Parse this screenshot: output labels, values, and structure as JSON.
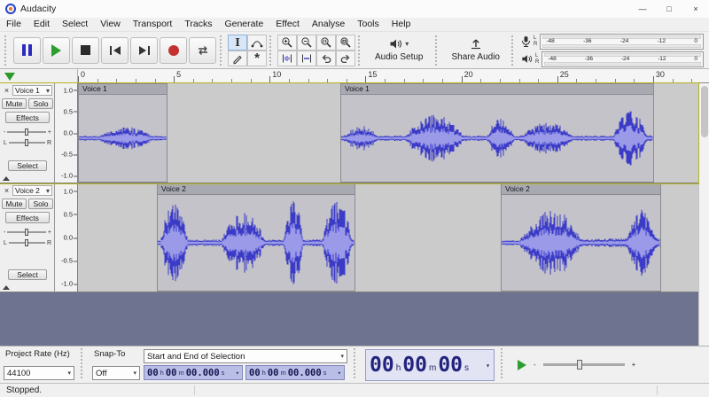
{
  "window": {
    "title": "Audacity"
  },
  "icons": {
    "minimize": "—",
    "maximize": "□",
    "close": "×",
    "dropdown": "▾",
    "multi_tool": "*",
    "selection_tool": "I"
  },
  "menu": {
    "items": [
      "File",
      "Edit",
      "Select",
      "View",
      "Transport",
      "Tracks",
      "Generate",
      "Effect",
      "Analyse",
      "Tools",
      "Help"
    ]
  },
  "toolbar": {
    "audio_setup_label": "Audio Setup",
    "share_audio_label": "Share Audio"
  },
  "meters": {
    "channels": [
      "L",
      "R"
    ],
    "scale": [
      "-48",
      "-36",
      "-24",
      "-12",
      "0"
    ]
  },
  "timeline": {
    "ticks": [
      "0",
      "5",
      "10",
      "15",
      "20",
      "25",
      "30"
    ]
  },
  "scale": [
    "1.0",
    "0.5",
    "0.0",
    "-0.5",
    "-1.0"
  ],
  "panel": {
    "mute": "Mute",
    "solo": "Solo",
    "effects": "Effects",
    "select": "Select",
    "gain_minus": "-",
    "gain_plus": "+",
    "pan_left": "L",
    "pan_right": "R"
  },
  "tracks": [
    {
      "name": "Voice 1",
      "clips": [
        {
          "label": "Voice 1",
          "start": 0,
          "end": 4.65,
          "seed": 3,
          "intensity": 0.75
        },
        {
          "label": "Voice 1",
          "start": 13.7,
          "end": 30.05,
          "seed": 11,
          "intensity": 0.85
        }
      ]
    },
    {
      "name": "Voice 2",
      "clips": [
        {
          "label": "Voice 2",
          "start": 4.1,
          "end": 14.45,
          "seed": 5,
          "intensity": 0.95
        },
        {
          "label": "Voice 2",
          "start": 22.05,
          "end": 30.4,
          "seed": 9,
          "intensity": 1.15,
          "ramp": true
        }
      ]
    }
  ],
  "bottom": {
    "project_rate_label": "Project Rate (Hz)",
    "project_rate_value": "44100",
    "snap_label": "Snap-To",
    "snap_value": "Off",
    "selection_mode": "Start and End of Selection",
    "units": {
      "h": "h",
      "m": "m",
      "s": "s"
    },
    "start": {
      "h": "00",
      "m": "00",
      "s": "00.000"
    },
    "end": {
      "h": "00",
      "m": "00",
      "s": "00.000"
    }
  },
  "bigtime": {
    "h": "00",
    "m": "00",
    "s": "00"
  },
  "status": {
    "text": "Stopped."
  },
  "colors": {
    "wave": "#3b3bc8",
    "wave_inner": "#9a9ae8",
    "play_green": "#2d9e2d",
    "record_red": "#c43131",
    "pause_blue": "#2b2bbf",
    "selected_track_border": "#b5b520"
  }
}
